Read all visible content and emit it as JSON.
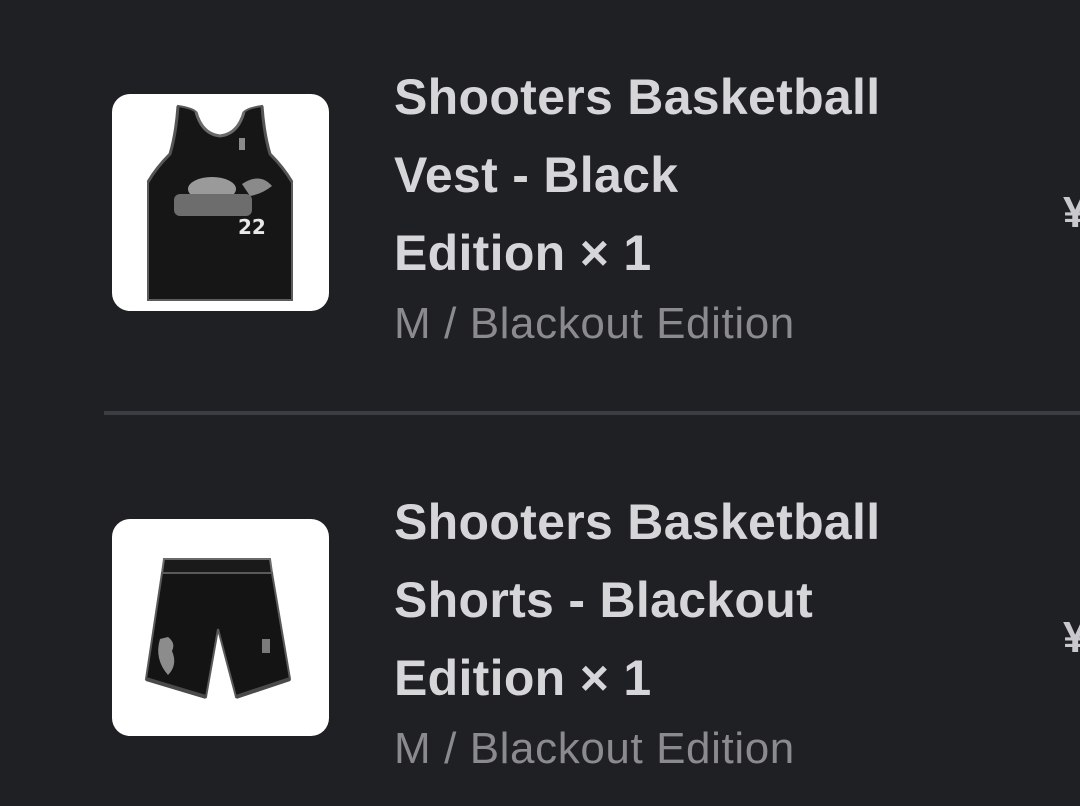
{
  "cart": {
    "items": [
      {
        "title_lines": [
          "Shooters Basketball",
          "Vest - Black",
          "Edition × 1"
        ],
        "variant": "M / Blackout Edition",
        "price": "¥",
        "image_icon": "basketball-vest-image",
        "jersey_number": "22"
      },
      {
        "title_lines": [
          "Shooters Basketball",
          "Shorts - Blackout",
          "Edition × 1"
        ],
        "variant": "M / Blackout Edition",
        "price": "¥",
        "image_icon": "basketball-shorts-image"
      }
    ]
  },
  "colors": {
    "background": "#1f2024",
    "title_text": "#d6d6d9",
    "variant_text": "#8a8a8f",
    "divider": "#3c3d42"
  }
}
